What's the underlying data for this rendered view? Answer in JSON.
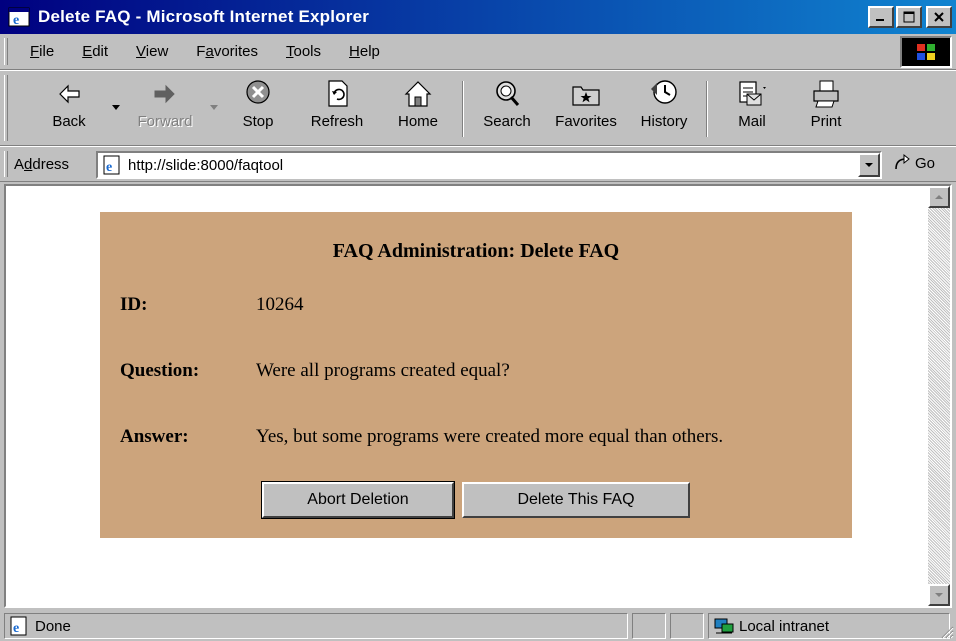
{
  "window": {
    "title": "Delete FAQ - Microsoft Internet Explorer",
    "icons": {
      "app": "internet-explorer-icon",
      "minimize": "minimize-icon",
      "maximize": "maximize-icon",
      "close": "close-icon"
    }
  },
  "menubar": {
    "items": [
      {
        "label": "File",
        "hotkey": "F"
      },
      {
        "label": "Edit",
        "hotkey": "E"
      },
      {
        "label": "View",
        "hotkey": "V"
      },
      {
        "label": "Favorites",
        "hotkey": "a"
      },
      {
        "label": "Tools",
        "hotkey": "T"
      },
      {
        "label": "Help",
        "hotkey": "H"
      }
    ]
  },
  "toolbar": {
    "back": "Back",
    "forward": "Forward",
    "stop": "Stop",
    "refresh": "Refresh",
    "home": "Home",
    "search": "Search",
    "favorites": "Favorites",
    "history": "History",
    "mail": "Mail",
    "print": "Print"
  },
  "address": {
    "label": "Address",
    "url": "http://slide:8000/faqtool",
    "go": "Go"
  },
  "page": {
    "title": "FAQ Administration: Delete FAQ",
    "id_label": "ID:",
    "id_value": "10264",
    "question_label": "Question:",
    "question_value": "Were all programs created equal?",
    "answer_label": "Answer:",
    "answer_value": "Yes, but some programs were created more equal than others.",
    "abort_button": "Abort Deletion",
    "delete_button": "Delete This FAQ",
    "panel_color": "#cca47c"
  },
  "statusbar": {
    "text": "Done",
    "zone": "Local intranet"
  },
  "colors": {
    "titlebar_start": "#000080",
    "titlebar_end": "#1084d0",
    "chrome": "#c0c0c0"
  }
}
